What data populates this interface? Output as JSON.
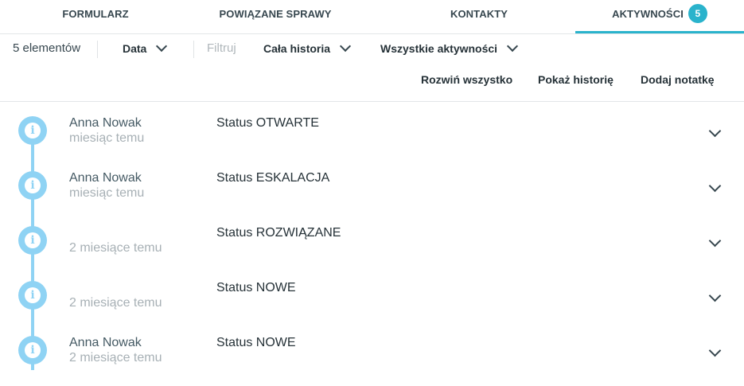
{
  "tabs": [
    {
      "label": "FORMULARZ"
    },
    {
      "label": "POWIĄZANE SPRAWY"
    },
    {
      "label": "KONTAKTY"
    },
    {
      "label": "AKTYWNOŚCI",
      "badge": "5"
    }
  ],
  "toolbar": {
    "count": "5 elementów",
    "sort": "Data",
    "filter_placeholder": "Filtruj",
    "history": "Cała historia",
    "activities": "Wszystkie aktywności"
  },
  "actions": {
    "expand_all": "Rozwiń wszystko",
    "show_history": "Pokaż historię",
    "add_note": "Dodaj notatkę"
  },
  "entries": [
    {
      "author": "Anna Nowak",
      "time": "miesiąc temu",
      "status": "Status OTWARTE",
      "icon": "info-icon"
    },
    {
      "author": "Anna Nowak",
      "time": "miesiąc temu",
      "status": "Status ESKALACJA",
      "icon": "info-icon"
    },
    {
      "author": "",
      "time": "2 miesiące temu",
      "status": "Status ROZWIĄZANE",
      "icon": "info-icon"
    },
    {
      "author": "",
      "time": "2 miesiące temu",
      "status": "Status NOWE",
      "icon": "info-icon"
    },
    {
      "author": "Anna Nowak",
      "time": "2 miesiące temu",
      "status": "Status NOWE",
      "icon": "info-icon"
    }
  ],
  "colors": {
    "accent": "#2ab3cc",
    "timeline": "#8fd3f4"
  }
}
